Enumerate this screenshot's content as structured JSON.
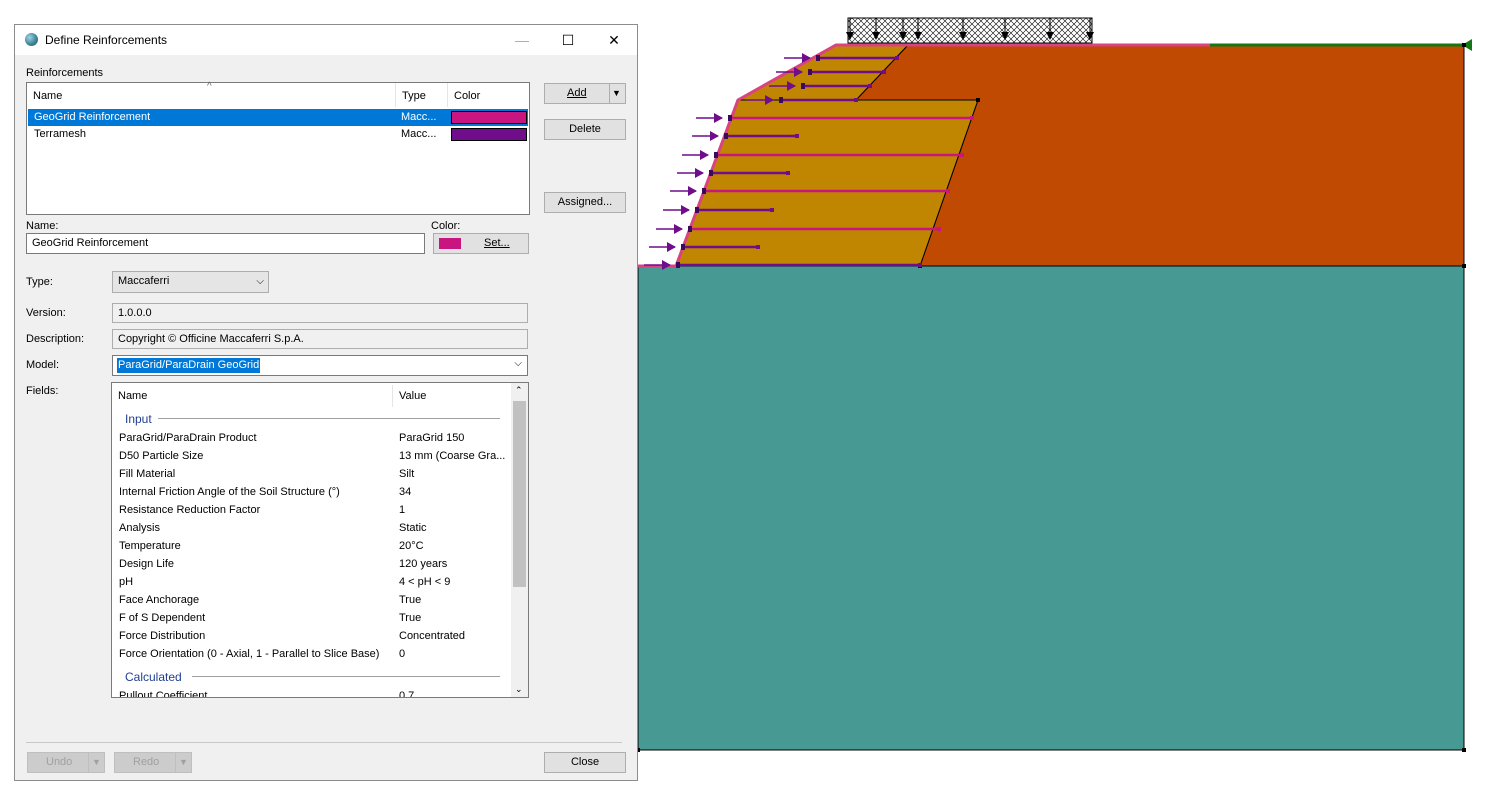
{
  "dialog": {
    "title": "Define Reinforcements",
    "window_buttons": {
      "minimize": "—",
      "maximize": "☐",
      "close": "✕"
    },
    "reinforcements_label": "Reinforcements",
    "columns": {
      "name": "Name",
      "type": "Type",
      "color": "Color"
    },
    "items": [
      {
        "name": "GeoGrid Reinforcement",
        "type": "Macc...",
        "color": "#c8157f"
      },
      {
        "name": "Terramesh",
        "type": "Macc...",
        "color": "#6f0d8a"
      }
    ],
    "buttons": {
      "add": "Add",
      "delete": "Delete",
      "assigned": "Assigned...",
      "set": "Set...",
      "undo": "Undo",
      "redo": "Redo",
      "close": "Close"
    },
    "name_label": "Name:",
    "name_value": "GeoGrid Reinforcement",
    "color_label": "Color:",
    "current_color": "#c8157f",
    "type_label": "Type:",
    "type_value": "Maccaferri",
    "version_label": "Version:",
    "version_value": "1.0.0.0",
    "description_label": "Description:",
    "description_value": "Copyright © Officine Maccaferri S.p.A.",
    "model_label": "Model:",
    "model_value": "ParaGrid/ParaDrain GeoGrid",
    "fields_label": "Fields:",
    "fields_columns": {
      "name": "Name",
      "value": "Value"
    },
    "input_section": "Input",
    "fields": [
      {
        "name": "ParaGrid/ParaDrain Product",
        "value": "ParaGrid 150"
      },
      {
        "name": "D50 Particle Size",
        "value": "13 mm (Coarse Gra..."
      },
      {
        "name": "Fill Material",
        "value": "Silt"
      },
      {
        "name": "Internal Friction Angle of the Soil Structure (°)",
        "value": "34"
      },
      {
        "name": "Resistance Reduction Factor",
        "value": "1"
      },
      {
        "name": "Analysis",
        "value": "Static"
      },
      {
        "name": "Temperature",
        "value": "20°C"
      },
      {
        "name": "Design Life",
        "value": "120 years"
      },
      {
        "name": "pH",
        "value": "4 < pH < 9"
      },
      {
        "name": "Face Anchorage",
        "value": "True"
      },
      {
        "name": "F of S Dependent",
        "value": "True"
      },
      {
        "name": "Force Distribution",
        "value": "Concentrated"
      },
      {
        "name": "Force Orientation (0 - Axial, 1 - Parallel to Slice Base)",
        "value": "0"
      }
    ],
    "calculated_section": "Calculated",
    "calculated_fields": [
      {
        "name": "Pullout Coefficient",
        "value": "0.7"
      }
    ]
  },
  "model_view": {
    "colors": {
      "foundation": "#469a93",
      "embankment": "#c04a02",
      "reinforced_fill": "#c18601",
      "geogrid": "#c8157f",
      "terramesh": "#6f0d8a",
      "ground_line": "#127812"
    }
  }
}
